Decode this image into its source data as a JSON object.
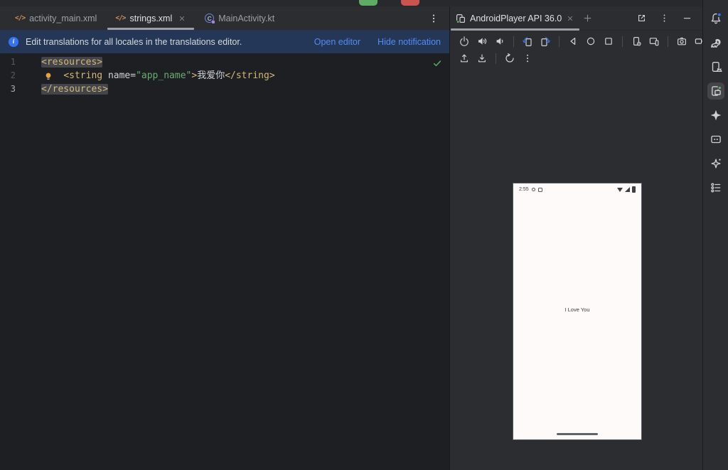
{
  "colors": {
    "accent_blue": "#3574f0",
    "link_blue": "#548af7",
    "banner_bg": "#253757",
    "tag_gold": "#d5b778",
    "string_green": "#6aab73",
    "check_green": "#57a65c",
    "run_green": "#5fad65",
    "stop_red": "#cc5450"
  },
  "icons": {
    "xml_file_glyph": "</>",
    "kotlin_class_letter": "C"
  },
  "editor_tabs": [
    {
      "label": "activity_main.xml",
      "active": false
    },
    {
      "label": "strings.xml",
      "active": true
    },
    {
      "label": "MainActivity.kt",
      "active": false
    }
  ],
  "banner": {
    "message": "Edit translations for all locales in the translations editor.",
    "open_editor": "Open editor",
    "hide_notification": "Hide notification"
  },
  "editor": {
    "line_numbers": [
      "1",
      "2",
      "3"
    ],
    "line1": {
      "tag": "<resources>"
    },
    "line2": {
      "indent": "    ",
      "tag_open": "<string",
      "space": " ",
      "attr": "name",
      "eq": "=",
      "value": "\"app_name\"",
      "bracket": ">",
      "text": "我爱你",
      "tag_close": "</string>"
    },
    "line3": {
      "tag": "</resources>"
    }
  },
  "device_panel": {
    "tab_title": "AndroidPlayer API 36.0",
    "emulator_toolbar": {
      "row1_icons": [
        "power",
        "volume-up",
        "volume-down",
        "rotate-left",
        "rotate-right",
        "back",
        "home",
        "overview",
        "device-settings",
        "external-display",
        "screenshot",
        "screen-record",
        "zoom-controls"
      ],
      "row2_icons": [
        "upload-file",
        "download-file",
        "snapshots",
        "more-options"
      ]
    },
    "phone": {
      "status_time": "2:55",
      "status_icons": [
        "alarm-icon",
        "screenshot-icon",
        "wifi-icon",
        "signal-icon",
        "battery-icon"
      ],
      "app_text": "I Love You"
    }
  },
  "right_toolbar_icons": [
    "notifications",
    "gradle",
    "device-manager",
    "running-devices",
    "gemini",
    "logcat",
    "ai-assistant",
    "structure"
  ]
}
